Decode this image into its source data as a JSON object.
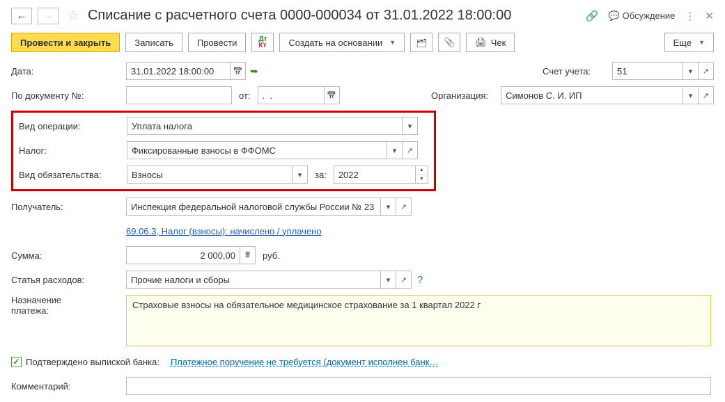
{
  "header": {
    "title": "Списание с расчетного счета 0000-000034 от 31.01.2022 18:00:00",
    "discuss": "Обсуждение"
  },
  "toolbar": {
    "post_close": "Провести и закрыть",
    "save": "Записать",
    "post": "Провести",
    "create_based": "Создать на основании",
    "cheque": "Чек",
    "more": "Еще"
  },
  "labels": {
    "date": "Дата:",
    "account": "Счет учета:",
    "by_doc": "По документу №:",
    "from": "от:",
    "org": "Организация:",
    "op_type": "Вид операции:",
    "tax": "Налог:",
    "obligation": "Вид обязательства:",
    "for": "за:",
    "recipient": "Получатель:",
    "sum": "Сумма:",
    "rub": "руб.",
    "expense": "Статья расходов:",
    "purpose1": "Назначение",
    "purpose2": "платежа:",
    "confirmed": "Подтверждено выпиской банка:",
    "payorder_note": "Платежное поручение не требуется (документ исполнен банк…",
    "comment": "Комментарий:"
  },
  "values": {
    "date": "31.01.2022 18:00:00",
    "account": "51",
    "doc_no": "",
    "doc_from": ".  .",
    "org": "Симонов С. И. ИП",
    "op_type": "Уплата налога",
    "tax": "Фиксированные взносы в ФФОМС",
    "obligation": "Взносы",
    "year": "2022",
    "recipient": "Инспекция федеральной налоговой службы России № 23",
    "account_link": "69.06.3, Налог (взносы): начислено / уплачено",
    "sum": "2 000,00",
    "expense": "Прочие налоги и сборы",
    "purpose": "Страховые взносы на обязательное медицинское страхование за 1 квартал 2022 г",
    "comment": ""
  }
}
